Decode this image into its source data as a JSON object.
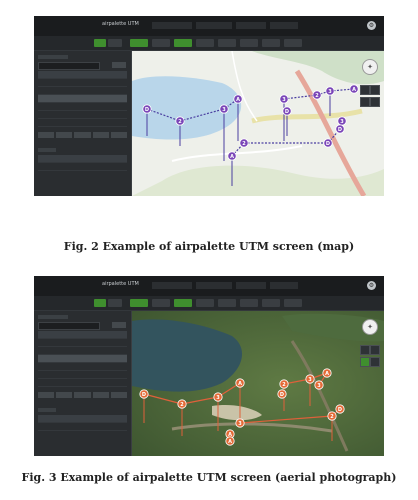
{
  "figures": [
    {
      "caption": "Fig. 2    Example of airpalette UTM screen (map)",
      "view": "map",
      "app_title": "airpalette UTM",
      "route_markers": [
        "D",
        "2",
        "3",
        "A",
        "3",
        "2",
        "D",
        "3",
        "A",
        "3",
        "A",
        "2",
        "D",
        "D"
      ]
    },
    {
      "caption": "Fig. 3    Example of airpalette UTM screen (aerial photograph)",
      "view": "aerial",
      "app_title": "airpalette UTM",
      "route_markers": [
        "D",
        "2",
        "3",
        "A",
        "2",
        "3",
        "D",
        "A",
        "3",
        "2",
        "A",
        "D",
        "3",
        "A"
      ]
    }
  ],
  "colors": {
    "app_bg": "#1f2224",
    "toolbar_green": "#3f8f2e",
    "map_route": "#4a3ea0",
    "aerial_route": "#e0603a",
    "marker_map": "#7a45b8",
    "marker_aerial": "#e46a36"
  },
  "icons": [
    "gear-icon",
    "compass-icon"
  ]
}
